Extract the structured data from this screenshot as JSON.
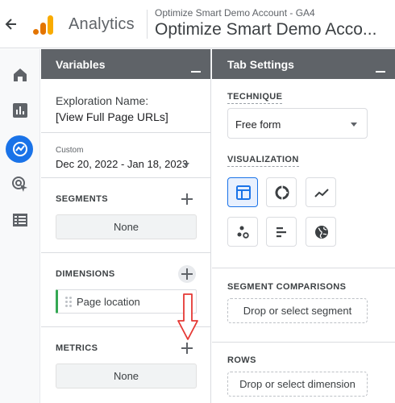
{
  "header": {
    "app_name": "Analytics",
    "account_small": "Optimize Smart Demo Account - GA4",
    "account_big": "Optimize Smart Demo Acco..."
  },
  "rail": {
    "items": [
      "home-icon",
      "reports-icon",
      "explore-icon",
      "advertising-icon",
      "configure-icon"
    ],
    "active": "explore-icon"
  },
  "variables": {
    "title": "Variables",
    "exploration_label": "Exploration Name:",
    "exploration_name": "[View Full Page URLs]",
    "date_custom": "Custom",
    "date_range": "Dec 20, 2022 - Jan 18, 2023",
    "segments": {
      "title": "SEGMENTS",
      "value": "None"
    },
    "dimensions": {
      "title": "DIMENSIONS",
      "items": [
        "Page location"
      ]
    },
    "metrics": {
      "title": "METRICS",
      "value": "None"
    }
  },
  "tab_settings": {
    "title": "Tab Settings",
    "technique": {
      "title": "TECHNIQUE",
      "value": "Free form"
    },
    "visualization": {
      "title": "VISUALIZATION",
      "options": [
        "table-icon",
        "donut-chart-icon",
        "line-chart-icon",
        "scatter-icon",
        "bar-chart-icon",
        "geo-map-icon"
      ],
      "selected": "table-icon"
    },
    "segment_comparisons": {
      "title": "SEGMENT COMPARISONS",
      "placeholder": "Drop or select segment"
    },
    "rows": {
      "title": "ROWS",
      "placeholder": "Drop or select dimension"
    }
  },
  "colors": {
    "header_bg": "#5f6368",
    "accent": "#1a73e8",
    "annotation_arrow": "#e53935",
    "dimension_chip_accent": "#34a853"
  }
}
